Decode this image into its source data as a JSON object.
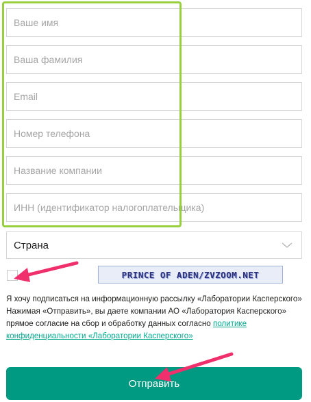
{
  "form": {
    "fields": [
      {
        "name": "first-name",
        "placeholder": "Ваше имя",
        "value": ""
      },
      {
        "name": "last-name",
        "placeholder": "Ваша фамилия",
        "value": ""
      },
      {
        "name": "email",
        "placeholder": "Email",
        "value": ""
      },
      {
        "name": "phone",
        "placeholder": "Номер телефона",
        "value": ""
      },
      {
        "name": "company",
        "placeholder": "Название компании",
        "value": ""
      },
      {
        "name": "inn",
        "placeholder": "ИНН (идентификатор налогоплательщика)",
        "value": ""
      }
    ],
    "country": {
      "selected": "Страна"
    },
    "subscribe_text": "Я хочу подписаться на информационную рассылку «Лаборатории Касперского»",
    "consent_text": "Нажимая «Отправить», вы даете компании АО «Лаборатория Касперского» прямое согласие на сбор и обработку данных согласно ",
    "privacy_link": "политике конфиденциальности «Лаборатории Касперского»",
    "submit_label": "Отправить"
  },
  "watermark": {
    "text": "PRINCE OF ADEN/ZVZOOM.NET"
  },
  "colors": {
    "highlight_green": "#97cf3f",
    "arrow_pink": "#f0306d",
    "button_teal": "#009982",
    "link_teal": "#00a88e"
  }
}
